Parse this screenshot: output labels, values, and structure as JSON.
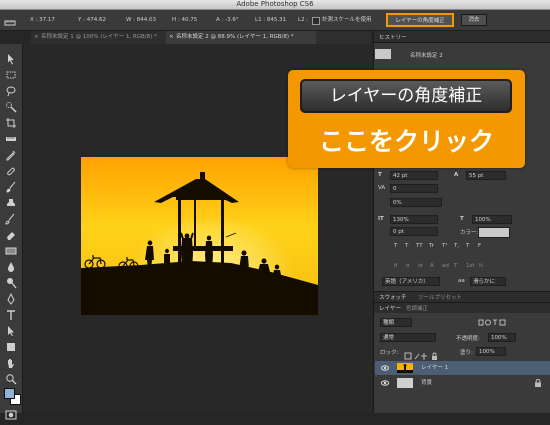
{
  "app": {
    "title": "Adobe Photoshop CS6"
  },
  "options_bar": {
    "x": "X : 37.17",
    "y": "Y : 474.62",
    "w": "W : 844.03",
    "h": "H : 40.75",
    "a": "A : -3.6°",
    "l1": "L1 : 845.31",
    "l2": "L2 :",
    "use_measurement_scale": "計測スケールを使用",
    "straighten_layer_button": "レイヤーの角度補正",
    "clear_button": "消去"
  },
  "tabs": [
    {
      "label": "名称未設定 1 @ 100% (レイヤー 1, RGB/8) *"
    },
    {
      "label": "名称未設定 2 @ 88.9% (レイヤー 1, RGB/8) *"
    }
  ],
  "callout": {
    "button_label": "レイヤーの角度補正",
    "instruction": "ここをクリック"
  },
  "right_panel": {
    "history_header": "ヒストリー",
    "history_item": "名称未設定 2",
    "char": {
      "font_size": "42 pt",
      "leading": "55 pt",
      "kerning_label": "VA",
      "kerning_value": "0",
      "tsume": "0%",
      "vscale": "130%",
      "hscale": "100%",
      "baseline": "0 pt",
      "color_label": "カラー:",
      "type_buttons": [
        "T",
        "T",
        "TT",
        "Tr",
        "T¹",
        "T,",
        "T",
        "F"
      ],
      "opentype_buttons": [
        "fi",
        "ơ",
        "st",
        "A",
        "ad",
        "T",
        "1st",
        "½"
      ],
      "language": "英語（アメリカ）",
      "antialias_icon": "aa",
      "antialias": "滑らかに"
    },
    "swatch_tabs": [
      "スウォッチ",
      "ツールプリセット"
    ],
    "layer_tabs": [
      "レイヤー",
      "色調補正"
    ],
    "kind_label": "種類",
    "blend_mode": "通常",
    "opacity_label": "不透明度:",
    "opacity_value": "100%",
    "lock_label": "ロック:",
    "fill_label": "塗り:",
    "fill_value": "100%",
    "layers": [
      {
        "name": "レイヤー 1",
        "selected": true
      },
      {
        "name": "背景",
        "selected": false
      }
    ]
  },
  "colors": {
    "accent_orange": "#f39800",
    "panel": "#3a3a3a",
    "selected_layer": "#4b5e74"
  }
}
